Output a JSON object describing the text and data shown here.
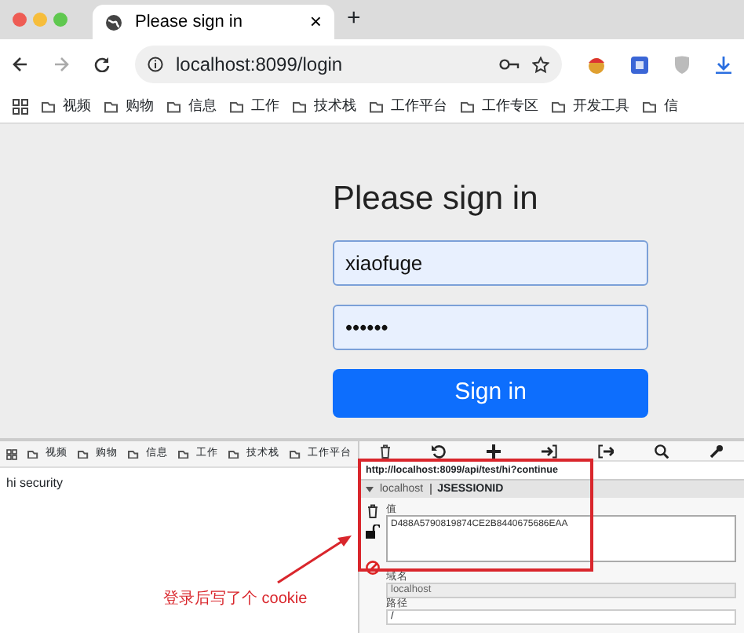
{
  "browser": {
    "tab": {
      "title": "Please sign in",
      "close": "×",
      "selected": true
    },
    "new_tab": "+",
    "address": "localhost:8099/login",
    "bookmarks": [
      "视频",
      "购物",
      "信息",
      "工作",
      "技术栈",
      "工作平台",
      "工作专区",
      "开发工具",
      "信"
    ]
  },
  "login": {
    "heading": "Please sign in",
    "username": "xiaofuge",
    "password": "••••••",
    "button": "Sign in"
  },
  "lower": {
    "bookmarks": [
      "视频",
      "购物",
      "信息",
      "工作",
      "技术栈",
      "工作平台"
    ],
    "body_text": "hi security"
  },
  "cookie_editor": {
    "url": "http://localhost:8099/api/test/hi?continue",
    "expanded": true,
    "cookie_domain": "localhost",
    "cookie_name": "JSESSIONID",
    "value_label": "值",
    "value": "D488A5790819874CE2B8440675686EAA",
    "domain_label": "域名",
    "domain": "localhost",
    "path_label": "路径",
    "path": "/"
  },
  "annotation": "登录后写了个 cookie"
}
